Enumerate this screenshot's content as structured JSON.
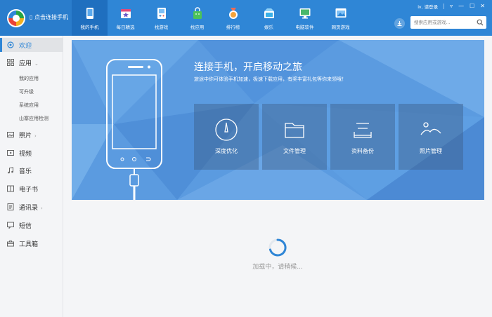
{
  "header": {
    "connect_text": "点击连接手机",
    "user_link": "请登录",
    "controls": [
      "▿",
      "—",
      "☐",
      "✕"
    ],
    "nav": [
      {
        "label": "我的手机",
        "icon": "phone-icon",
        "active": true
      },
      {
        "label": "每日精选",
        "icon": "calendar-star-icon"
      },
      {
        "label": "找游戏",
        "icon": "gamepad-icon"
      },
      {
        "label": "找应用",
        "icon": "android-bag-icon"
      },
      {
        "label": "排行榜",
        "icon": "medal-icon"
      },
      {
        "label": "娱乐",
        "icon": "entertainment-icon"
      },
      {
        "label": "电脑软件",
        "icon": "monitor-icon"
      },
      {
        "label": "网页游戏",
        "icon": "web-game-icon"
      }
    ],
    "search": {
      "placeholder": "搜索应用或游戏..."
    }
  },
  "sidebar": {
    "items": [
      {
        "label": "欢迎",
        "icon": "welcome-icon",
        "active": true
      },
      {
        "label": "应用",
        "icon": "apps-grid-icon",
        "caret": "⌄"
      },
      {
        "label": "照片",
        "icon": "photo-icon",
        "caret": "›"
      },
      {
        "label": "视频",
        "icon": "video-icon"
      },
      {
        "label": "音乐",
        "icon": "music-icon"
      },
      {
        "label": "电子书",
        "icon": "ebook-icon"
      },
      {
        "label": "通讯录",
        "icon": "contacts-icon",
        "caret": "›"
      },
      {
        "label": "短信",
        "icon": "sms-icon"
      },
      {
        "label": "工具箱",
        "icon": "toolbox-icon"
      }
    ],
    "app_subitems": [
      "我的应用",
      "可升级",
      "系统应用",
      "山寨应用检测"
    ]
  },
  "banner": {
    "title": "连接手机，开启移动之旅",
    "subtitle": "旅途中你可体验手机加速，极速下载应用，有奖丰富礼包等你来领哦！",
    "tiles": [
      {
        "label": "深度优化",
        "icon": "gauge-icon"
      },
      {
        "label": "文件管理",
        "icon": "folder-icon"
      },
      {
        "label": "资料备份",
        "icon": "backup-icon"
      },
      {
        "label": "照片管理",
        "icon": "photo-manage-icon"
      }
    ]
  },
  "loading": {
    "text": "加载中，请稍候..."
  },
  "colors": {
    "accent": "#2f86d6",
    "nav_active": "#1f6fbf",
    "banner": "#5b9be0"
  }
}
